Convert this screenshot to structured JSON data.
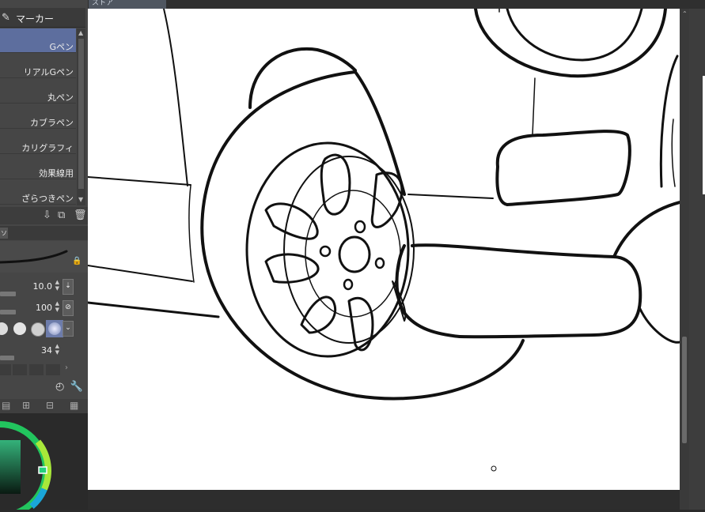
{
  "topbar": {
    "tab_label": "ストア"
  },
  "tool_header": {
    "label": "マーカー",
    "icon": "marker-icon"
  },
  "brushes": {
    "items": [
      {
        "label": "Gペン",
        "selected": true
      },
      {
        "label": "リアルGペン"
      },
      {
        "label": "丸ペン"
      },
      {
        "label": "カブラペン"
      },
      {
        "label": "カリグラフィ"
      },
      {
        "label": "効果線用"
      },
      {
        "label": "ざらつきペン"
      }
    ]
  },
  "list_toolbar": {
    "icons": [
      "import-icon",
      "duplicate-icon",
      "delete-icon"
    ]
  },
  "subtool_tab": {
    "label": "ソ"
  },
  "properties": {
    "brush_size": {
      "value": "10.0"
    },
    "opacity": {
      "value": "100"
    },
    "stabilization": {
      "value": "34"
    }
  },
  "tip_shapes": [
    "soft-tip",
    "hard-tip",
    "gray-tip",
    "blur-tip"
  ],
  "accent": {
    "selected_brush": "#5d6e9e",
    "canvas": "#ffffff",
    "panel": "#464646"
  }
}
